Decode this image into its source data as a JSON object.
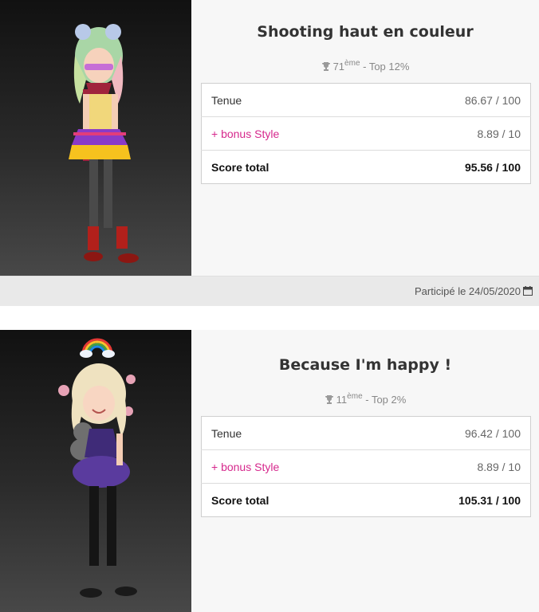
{
  "entries": [
    {
      "title": "Shooting haut en couleur",
      "rank_number": "71",
      "rank_suffix": "ème",
      "rank_top": " - Top 12%",
      "rows": [
        {
          "label": "Tenue",
          "value": "86.67 / 100"
        },
        {
          "label": "+ bonus Style",
          "value": "8.89 / 10"
        },
        {
          "label": "Score total",
          "value": "95.56 / 100"
        }
      ],
      "participation": "Participé le 24/05/2020"
    },
    {
      "title": "Because I'm happy !",
      "rank_number": "11",
      "rank_suffix": "ème",
      "rank_top": " - Top 2%",
      "rows": [
        {
          "label": "Tenue",
          "value": "96.42 / 100"
        },
        {
          "label": "+ bonus Style",
          "value": "8.89 / 10"
        },
        {
          "label": "Score total",
          "value": "105.31 / 100"
        }
      ]
    }
  ],
  "icons": {
    "rank": "trophy-icon",
    "date": "calendar-icon"
  },
  "colors": {
    "bonus": "#d6298d",
    "card_bg": "#f7f7f7",
    "footer_bg": "#e9e9e9"
  }
}
